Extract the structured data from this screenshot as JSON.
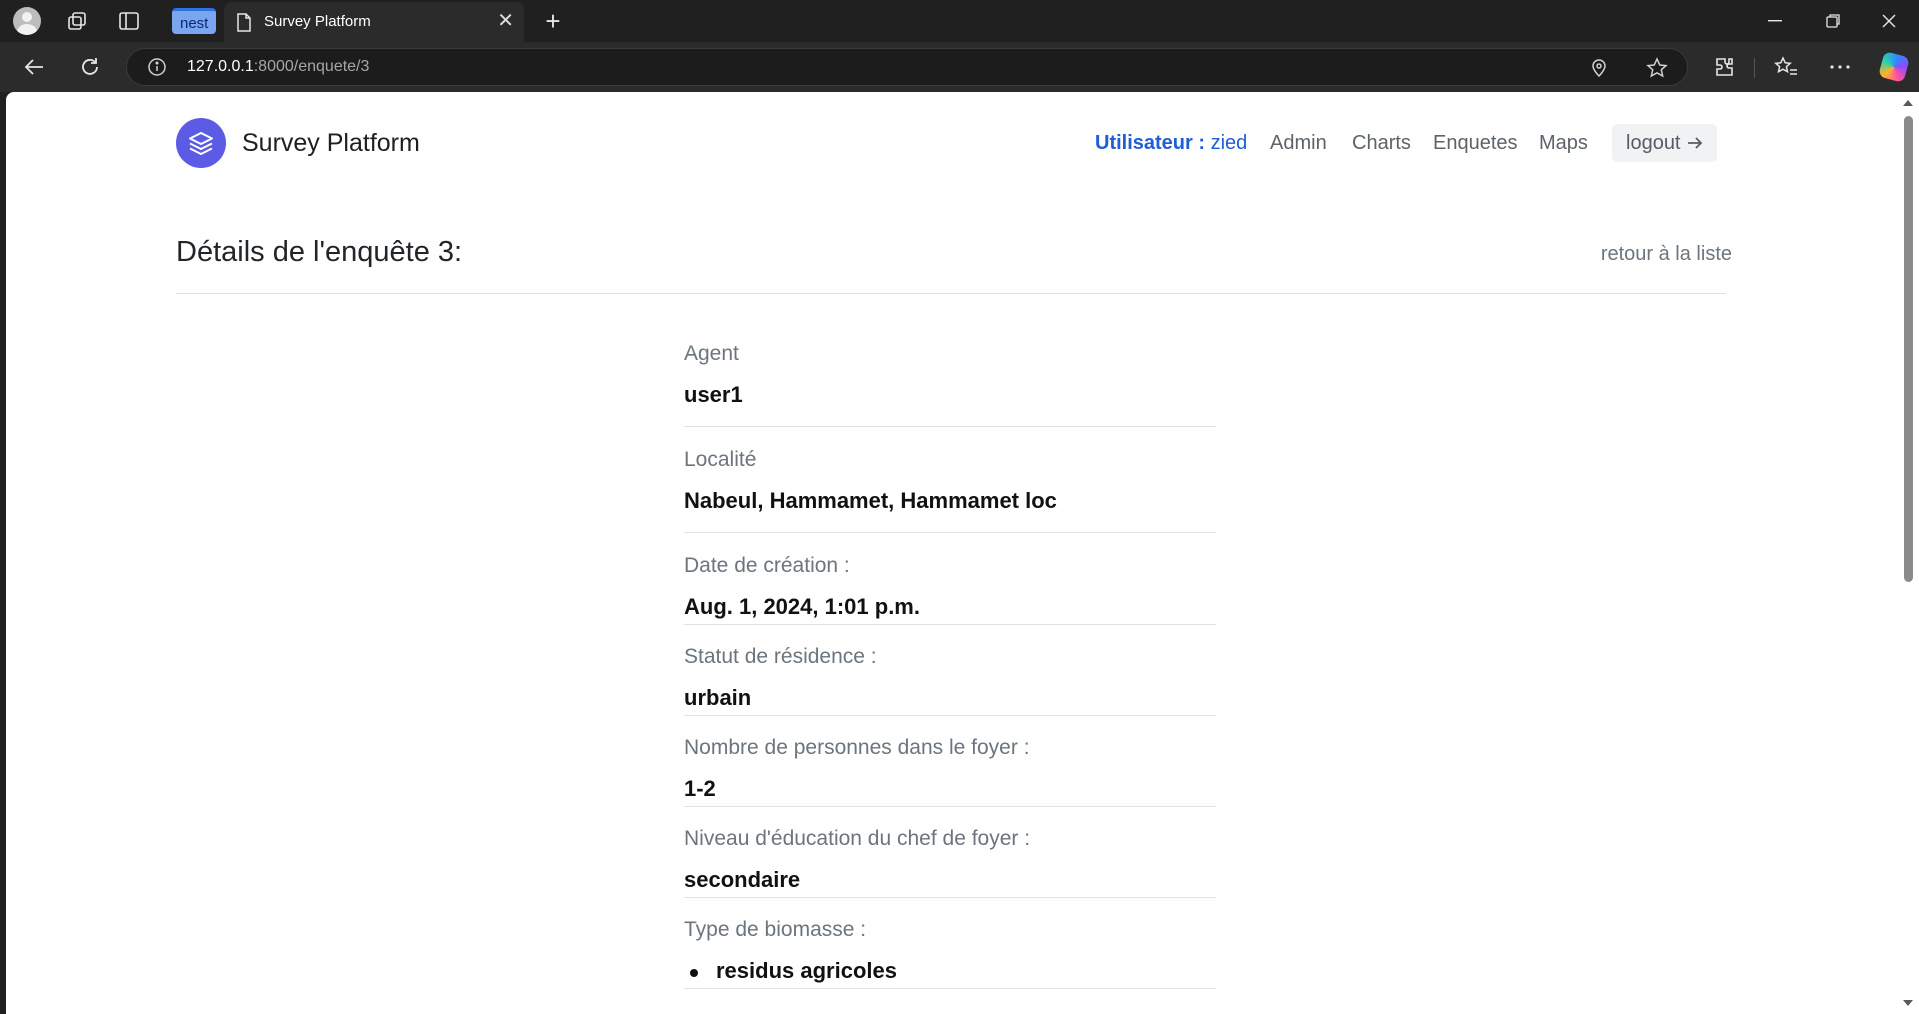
{
  "browser": {
    "tab_group_label": "nest",
    "tab_title": "Survey Platform",
    "url_host": "127.0.0.1",
    "url_rest": ":8000/enquete/3"
  },
  "navbar": {
    "brand": "Survey Platform",
    "user_label": "Utilisateur :",
    "user_name": "zied",
    "links": [
      "Admin",
      "Charts",
      "Enquetes",
      "Maps"
    ],
    "logout_label": "logout"
  },
  "page": {
    "title": "Détails de l'enquête 3:",
    "back_link": "retour à la liste"
  },
  "details": [
    {
      "label": "Agent",
      "value": "user1"
    },
    {
      "label": "Localité",
      "value": "Nabeul, Hammamet, Hammamet loc"
    },
    {
      "label": "Date de création :",
      "value": "Aug. 1, 2024, 1:01 p.m."
    },
    {
      "label": "Statut de résidence :",
      "value": "urbain"
    },
    {
      "label": "Nombre de personnes dans le foyer :",
      "value": "1-2"
    },
    {
      "label": "Niveau d'éducation du chef de foyer :",
      "value": "secondaire"
    },
    {
      "label": "Type de biomasse :",
      "value": "residus agricoles"
    }
  ]
}
